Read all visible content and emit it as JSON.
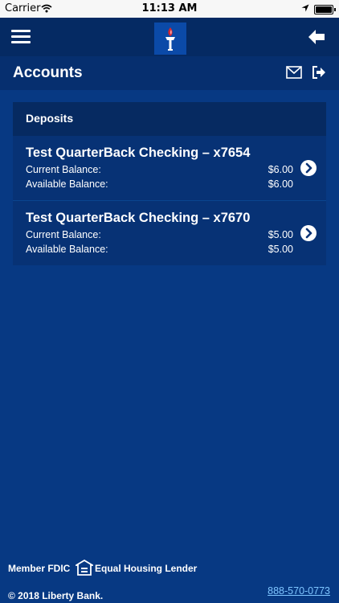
{
  "status_bar": {
    "carrier": "Carrier",
    "time": "11:13 AM"
  },
  "header": {
    "menu_icon": "hamburger-icon",
    "logo_icon": "torch-logo",
    "back_icon": "back-arrow-icon"
  },
  "page": {
    "title": "Accounts",
    "mail_icon": "envelope-icon",
    "logout_icon": "logout-icon"
  },
  "deposits": {
    "title": "Deposits",
    "accounts": [
      {
        "name": "Test QuarterBack Checking – x7654",
        "current_label": "Current Balance:",
        "current_value": "$6.00",
        "available_label": "Available Balance:",
        "available_value": "$6.00"
      },
      {
        "name": "Test QuarterBack Checking – x7670",
        "current_label": "Current Balance:",
        "current_value": "$5.00",
        "available_label": "Available Balance:",
        "available_value": "$5.00"
      }
    ]
  },
  "footer": {
    "fdic": "Member FDIC",
    "equal_housing": "Equal Housing Lender",
    "copyright": "© 2018 Liberty Bank.",
    "phone": "888-570-0773"
  },
  "colors": {
    "background": "#073983",
    "nav_bar": "#052a63",
    "panel": "#073275",
    "link": "#7ec5ff"
  }
}
